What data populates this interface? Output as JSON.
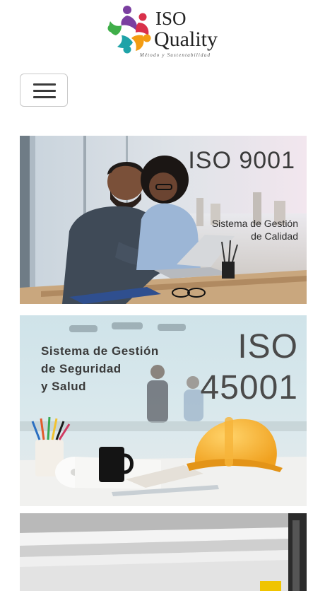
{
  "brand": {
    "line1": "ISO",
    "line2": "Quality",
    "tagline": "Método y Sustentabilidad"
  },
  "nav": {
    "toggle_icon": "hamburger-icon"
  },
  "banners": [
    {
      "title": "ISO 9001",
      "subtitle_line1": "Sistema de Gestión",
      "subtitle_line2": "de Calidad"
    },
    {
      "title_line1": "ISO",
      "title_line2": "45001",
      "subtitle_line1": "Sistema de Gestión",
      "subtitle_line2": "de Seguridad",
      "subtitle_line3": "y Salud"
    },
    {}
  ],
  "colors": {
    "logo_purple": "#7b3fa0",
    "logo_green": "#3fae49",
    "logo_orange": "#f39c12",
    "logo_teal": "#1fa3a8",
    "logo_red": "#d9304a",
    "helmet_yellow": "#f4a825"
  }
}
